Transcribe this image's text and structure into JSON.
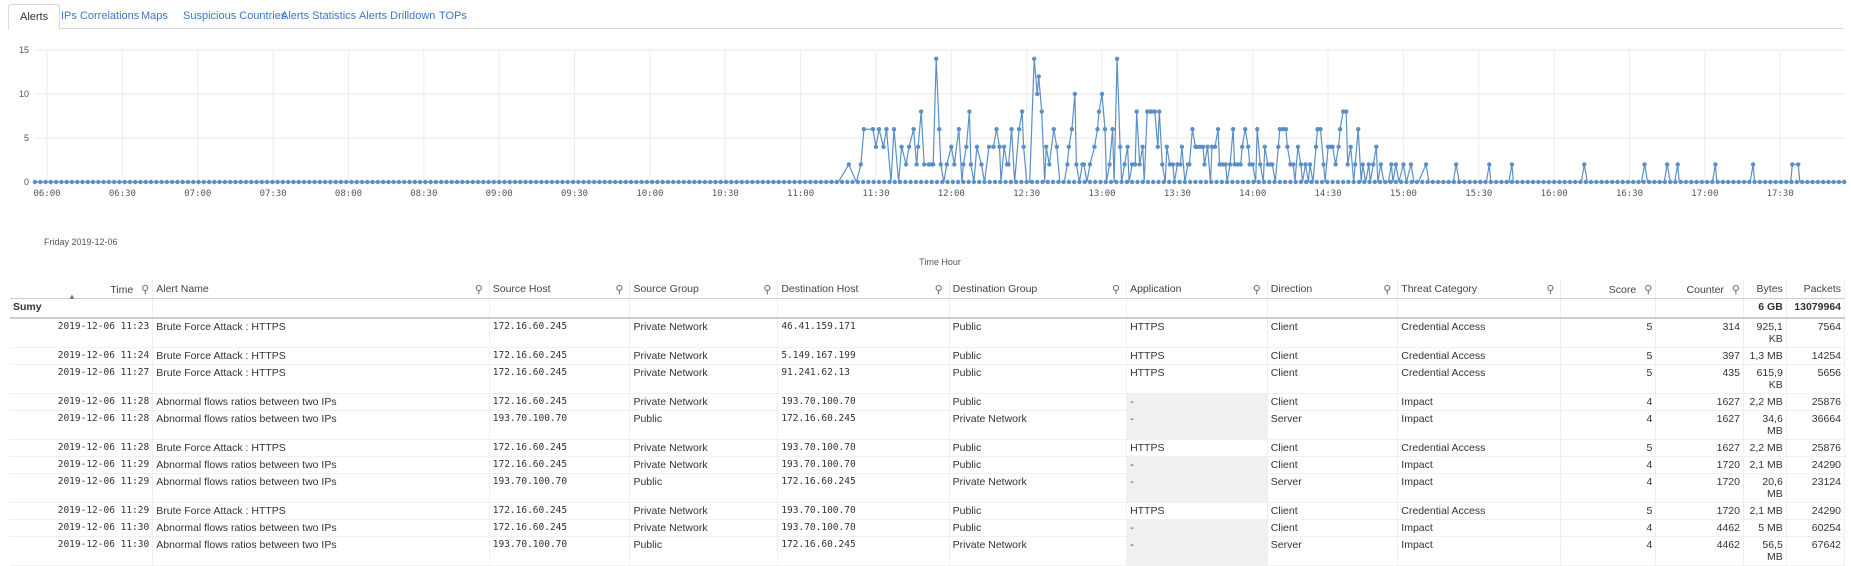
{
  "tabs": [
    {
      "label": "Alerts",
      "active": true
    },
    {
      "label": "IPs Correlations",
      "active": false
    },
    {
      "label": "Maps",
      "active": false
    },
    {
      "label": "Suspicious Countries",
      "active": false
    },
    {
      "label": "Alerts Statistics",
      "active": false
    },
    {
      "label": "Alerts Drilldown",
      "active": false
    },
    {
      "label": "TOPs",
      "active": false
    }
  ],
  "chart_data": {
    "type": "line",
    "xlabel": "Time Hour",
    "date_label": "Friday 2019-12-06",
    "y_ticks": [
      0,
      5,
      10,
      15
    ],
    "ylim": [
      0,
      15
    ],
    "x_ticks": [
      "06:00",
      "06:30",
      "07:00",
      "07:30",
      "08:00",
      "08:30",
      "09:00",
      "09:30",
      "10:00",
      "10:30",
      "11:00",
      "11:30",
      "12:00",
      "12:30",
      "13:00",
      "13:30",
      "14:00",
      "14:30",
      "15:00",
      "15:30",
      "16:00",
      "16:30",
      "17:00",
      "17:30"
    ],
    "x_start_hour": 5.92,
    "x_end_hour": 17.93,
    "color": "#5b8fc7",
    "series": [
      {
        "points": [
          [
            5.92,
            0
          ],
          [
            11.25,
            0
          ],
          [
            11.32,
            2
          ],
          [
            11.37,
            0
          ],
          [
            11.4,
            2
          ],
          [
            11.42,
            6
          ],
          [
            11.48,
            6
          ],
          [
            11.5,
            4
          ],
          [
            11.52,
            6
          ],
          [
            11.55,
            4
          ],
          [
            11.57,
            6
          ],
          [
            11.6,
            0
          ],
          [
            11.62,
            6
          ],
          [
            11.65,
            0
          ],
          [
            11.67,
            4
          ],
          [
            11.7,
            2
          ],
          [
            11.72,
            4
          ],
          [
            11.75,
            6
          ],
          [
            11.77,
            2
          ],
          [
            11.78,
            4
          ],
          [
            11.8,
            8
          ],
          [
            11.82,
            2
          ],
          [
            11.85,
            2
          ],
          [
            11.87,
            2
          ],
          [
            11.88,
            2
          ],
          [
            11.9,
            14
          ],
          [
            11.92,
            6
          ],
          [
            11.93,
            2
          ],
          [
            11.95,
            0
          ],
          [
            11.97,
            2
          ],
          [
            12.0,
            4
          ],
          [
            12.02,
            2
          ],
          [
            12.05,
            6
          ],
          [
            12.07,
            0
          ],
          [
            12.08,
            2
          ],
          [
            12.1,
            4
          ],
          [
            12.12,
            8
          ],
          [
            12.13,
            2
          ],
          [
            12.15,
            0
          ],
          [
            12.17,
            4
          ],
          [
            12.2,
            2
          ],
          [
            12.22,
            0
          ],
          [
            12.25,
            4
          ],
          [
            12.28,
            4
          ],
          [
            12.3,
            6
          ],
          [
            12.32,
            4
          ],
          [
            12.33,
            0
          ],
          [
            12.35,
            4
          ],
          [
            12.37,
            2
          ],
          [
            12.38,
            2
          ],
          [
            12.4,
            6
          ],
          [
            12.42,
            0
          ],
          [
            12.45,
            6
          ],
          [
            12.47,
            8
          ],
          [
            12.48,
            4
          ],
          [
            12.5,
            0
          ],
          [
            12.52,
            0
          ],
          [
            12.55,
            14
          ],
          [
            12.57,
            10
          ],
          [
            12.58,
            12
          ],
          [
            12.6,
            8
          ],
          [
            12.62,
            0
          ],
          [
            12.63,
            4
          ],
          [
            12.65,
            2
          ],
          [
            12.68,
            6
          ],
          [
            12.7,
            4
          ],
          [
            12.72,
            0
          ],
          [
            12.75,
            0
          ],
          [
            12.77,
            2
          ],
          [
            12.78,
            4
          ],
          [
            12.8,
            6
          ],
          [
            12.82,
            10
          ],
          [
            12.83,
            2
          ],
          [
            12.85,
            0
          ],
          [
            12.87,
            2
          ],
          [
            12.88,
            2
          ],
          [
            12.9,
            0
          ],
          [
            12.92,
            2
          ],
          [
            12.95,
            4
          ],
          [
            12.97,
            6
          ],
          [
            12.98,
            8
          ],
          [
            13.0,
            10
          ],
          [
            13.02,
            6
          ],
          [
            13.03,
            0
          ],
          [
            13.05,
            2
          ],
          [
            13.07,
            6
          ],
          [
            13.08,
            0
          ],
          [
            13.1,
            14
          ],
          [
            13.12,
            4
          ],
          [
            13.13,
            0
          ],
          [
            13.15,
            2
          ],
          [
            13.17,
            4
          ],
          [
            13.18,
            0
          ],
          [
            13.2,
            2
          ],
          [
            13.22,
            2
          ],
          [
            13.23,
            8
          ],
          [
            13.25,
            2
          ],
          [
            13.27,
            4
          ],
          [
            13.28,
            0
          ],
          [
            13.3,
            8
          ],
          [
            13.32,
            8
          ],
          [
            13.33,
            8
          ],
          [
            13.35,
            8
          ],
          [
            13.37,
            4
          ],
          [
            13.38,
            8
          ],
          [
            13.4,
            2
          ],
          [
            13.42,
            0
          ],
          [
            13.43,
            4
          ],
          [
            13.45,
            2
          ],
          [
            13.47,
            2
          ],
          [
            13.48,
            0
          ],
          [
            13.5,
            2
          ],
          [
            13.52,
            2
          ],
          [
            13.53,
            4
          ],
          [
            13.55,
            0
          ],
          [
            13.57,
            2
          ],
          [
            13.58,
            2
          ],
          [
            13.6,
            6
          ],
          [
            13.62,
            4
          ],
          [
            13.63,
            4
          ],
          [
            13.65,
            4
          ],
          [
            13.67,
            4
          ],
          [
            13.68,
            2
          ],
          [
            13.7,
            4
          ],
          [
            13.72,
            0
          ],
          [
            13.73,
            4
          ],
          [
            13.75,
            4
          ],
          [
            13.77,
            6
          ],
          [
            13.78,
            2
          ],
          [
            13.8,
            2
          ],
          [
            13.82,
            2
          ],
          [
            13.83,
            0
          ],
          [
            13.85,
            2
          ],
          [
            13.87,
            6
          ],
          [
            13.88,
            2
          ],
          [
            13.9,
            2
          ],
          [
            13.92,
            2
          ],
          [
            13.93,
            4
          ],
          [
            13.95,
            6
          ],
          [
            13.97,
            4
          ],
          [
            13.98,
            2
          ],
          [
            14.0,
            2
          ],
          [
            14.02,
            0
          ],
          [
            14.03,
            6
          ],
          [
            14.05,
            2
          ],
          [
            14.07,
            0
          ],
          [
            14.08,
            4
          ],
          [
            14.1,
            2
          ],
          [
            14.12,
            2
          ],
          [
            14.13,
            2
          ],
          [
            14.15,
            0
          ],
          [
            14.17,
            4
          ],
          [
            14.18,
            6
          ],
          [
            14.2,
            6
          ],
          [
            14.22,
            6
          ],
          [
            14.23,
            4
          ],
          [
            14.25,
            2
          ],
          [
            14.27,
            2
          ],
          [
            14.28,
            0
          ],
          [
            14.3,
            4
          ],
          [
            14.32,
            2
          ],
          [
            14.33,
            0
          ],
          [
            14.35,
            2
          ],
          [
            14.37,
            0
          ],
          [
            14.38,
            2
          ],
          [
            14.4,
            0
          ],
          [
            14.42,
            4
          ],
          [
            14.43,
            6
          ],
          [
            14.45,
            6
          ],
          [
            14.47,
            2
          ],
          [
            14.48,
            0
          ],
          [
            14.5,
            4
          ],
          [
            14.52,
            4
          ],
          [
            14.53,
            4
          ],
          [
            14.55,
            2
          ],
          [
            14.57,
            4
          ],
          [
            14.58,
            6
          ],
          [
            14.6,
            8
          ],
          [
            14.62,
            8
          ],
          [
            14.63,
            2
          ],
          [
            14.65,
            4
          ],
          [
            14.67,
            0
          ],
          [
            14.68,
            2
          ],
          [
            14.7,
            6
          ],
          [
            14.72,
            0
          ],
          [
            14.73,
            2
          ],
          [
            14.75,
            0
          ],
          [
            14.77,
            2
          ],
          [
            14.78,
            0
          ],
          [
            14.8,
            2
          ],
          [
            14.82,
            4
          ],
          [
            14.83,
            0
          ],
          [
            14.85,
            2
          ],
          [
            14.87,
            0
          ],
          [
            14.9,
            0
          ],
          [
            14.92,
            2
          ],
          [
            14.93,
            0
          ],
          [
            14.95,
            2
          ],
          [
            14.97,
            0
          ],
          [
            15.0,
            2
          ],
          [
            15.02,
            0
          ],
          [
            15.05,
            2
          ],
          [
            15.07,
            0
          ],
          [
            15.1,
            0
          ],
          [
            15.15,
            2
          ],
          [
            15.17,
            0
          ],
          [
            15.33,
            0
          ],
          [
            15.35,
            2
          ],
          [
            15.37,
            0
          ],
          [
            15.55,
            0
          ],
          [
            15.57,
            2
          ],
          [
            15.58,
            0
          ],
          [
            15.7,
            0
          ],
          [
            15.72,
            2
          ],
          [
            15.73,
            0
          ],
          [
            16.18,
            0
          ],
          [
            16.2,
            2
          ],
          [
            16.22,
            0
          ],
          [
            16.58,
            0
          ],
          [
            16.6,
            2
          ],
          [
            16.62,
            0
          ],
          [
            16.73,
            0
          ],
          [
            16.75,
            2
          ],
          [
            16.77,
            0
          ],
          [
            16.8,
            0
          ],
          [
            16.82,
            2
          ],
          [
            16.83,
            0
          ],
          [
            17.05,
            0
          ],
          [
            17.07,
            2
          ],
          [
            17.08,
            0
          ],
          [
            17.3,
            0
          ],
          [
            17.32,
            2
          ],
          [
            17.33,
            0
          ],
          [
            17.57,
            0
          ],
          [
            17.58,
            2
          ],
          [
            17.62,
            2
          ],
          [
            17.63,
            0
          ],
          [
            17.93,
            0
          ]
        ]
      }
    ]
  },
  "table": {
    "columns": [
      "Time",
      "Alert Name",
      "Source Host",
      "Source Group",
      "Destination Host",
      "Destination Group",
      "Application",
      "Direction",
      "Threat Category",
      "Score",
      "Counter",
      "Bytes",
      "Packets"
    ],
    "sum_label": "Sumy",
    "sum_bytes": "6 GB",
    "sum_packets": "13079964",
    "rows": [
      [
        "2019-12-06 11:23",
        "Brute Force Attack : HTTPS",
        "172.16.60.245",
        "Private Network",
        "46.41.159.171",
        "Public",
        "HTTPS",
        "Client",
        "Credential Access",
        "5",
        "314",
        "925,1 KB",
        "7564"
      ],
      [
        "2019-12-06 11:24",
        "Brute Force Attack : HTTPS",
        "172.16.60.245",
        "Private Network",
        "5.149.167.199",
        "Public",
        "HTTPS",
        "Client",
        "Credential Access",
        "5",
        "397",
        "1,3 MB",
        "14254"
      ],
      [
        "2019-12-06 11:27",
        "Brute Force Attack : HTTPS",
        "172.16.60.245",
        "Private Network",
        "91.241.62.13",
        "Public",
        "HTTPS",
        "Client",
        "Credential Access",
        "5",
        "435",
        "615,9 KB",
        "5656"
      ],
      [
        "2019-12-06 11:28",
        "Abnormal flows ratios between two IPs",
        "172.16.60.245",
        "Private Network",
        "193.70.100.70",
        "Public",
        "-",
        "Client",
        "Impact",
        "4",
        "1627",
        "2,2 MB",
        "25876"
      ],
      [
        "2019-12-06 11:28",
        "Abnormal flows ratios between two IPs",
        "193.70.100.70",
        "Public",
        "172.16.60.245",
        "Private Network",
        "-",
        "Server",
        "Impact",
        "4",
        "1627",
        "34,6 MB",
        "36664"
      ],
      [
        "2019-12-06 11:28",
        "Brute Force Attack : HTTPS",
        "172.16.60.245",
        "Private Network",
        "193.70.100.70",
        "Public",
        "HTTPS",
        "Client",
        "Credential Access",
        "5",
        "1627",
        "2,2 MB",
        "25876"
      ],
      [
        "2019-12-06 11:29",
        "Abnormal flows ratios between two IPs",
        "172.16.60.245",
        "Private Network",
        "193.70.100.70",
        "Public",
        "-",
        "Client",
        "Impact",
        "4",
        "1720",
        "2,1 MB",
        "24290"
      ],
      [
        "2019-12-06 11:29",
        "Abnormal flows ratios between two IPs",
        "193.70.100.70",
        "Public",
        "172.16.60.245",
        "Private Network",
        "-",
        "Server",
        "Impact",
        "4",
        "1720",
        "20,6 MB",
        "23124"
      ],
      [
        "2019-12-06 11:29",
        "Brute Force Attack : HTTPS",
        "172.16.60.245",
        "Private Network",
        "193.70.100.70",
        "Public",
        "HTTPS",
        "Client",
        "Credential Access",
        "5",
        "1720",
        "2,1 MB",
        "24290"
      ],
      [
        "2019-12-06 11:30",
        "Abnormal flows ratios between two IPs",
        "172.16.60.245",
        "Private Network",
        "193.70.100.70",
        "Public",
        "-",
        "Client",
        "Impact",
        "4",
        "4462",
        "5 MB",
        "60254"
      ],
      [
        "2019-12-06 11:30",
        "Abnormal flows ratios between two IPs",
        "193.70.100.70",
        "Public",
        "172.16.60.245",
        "Private Network",
        "-",
        "Server",
        "Impact",
        "4",
        "4462",
        "56,5 MB",
        "67642"
      ]
    ]
  }
}
